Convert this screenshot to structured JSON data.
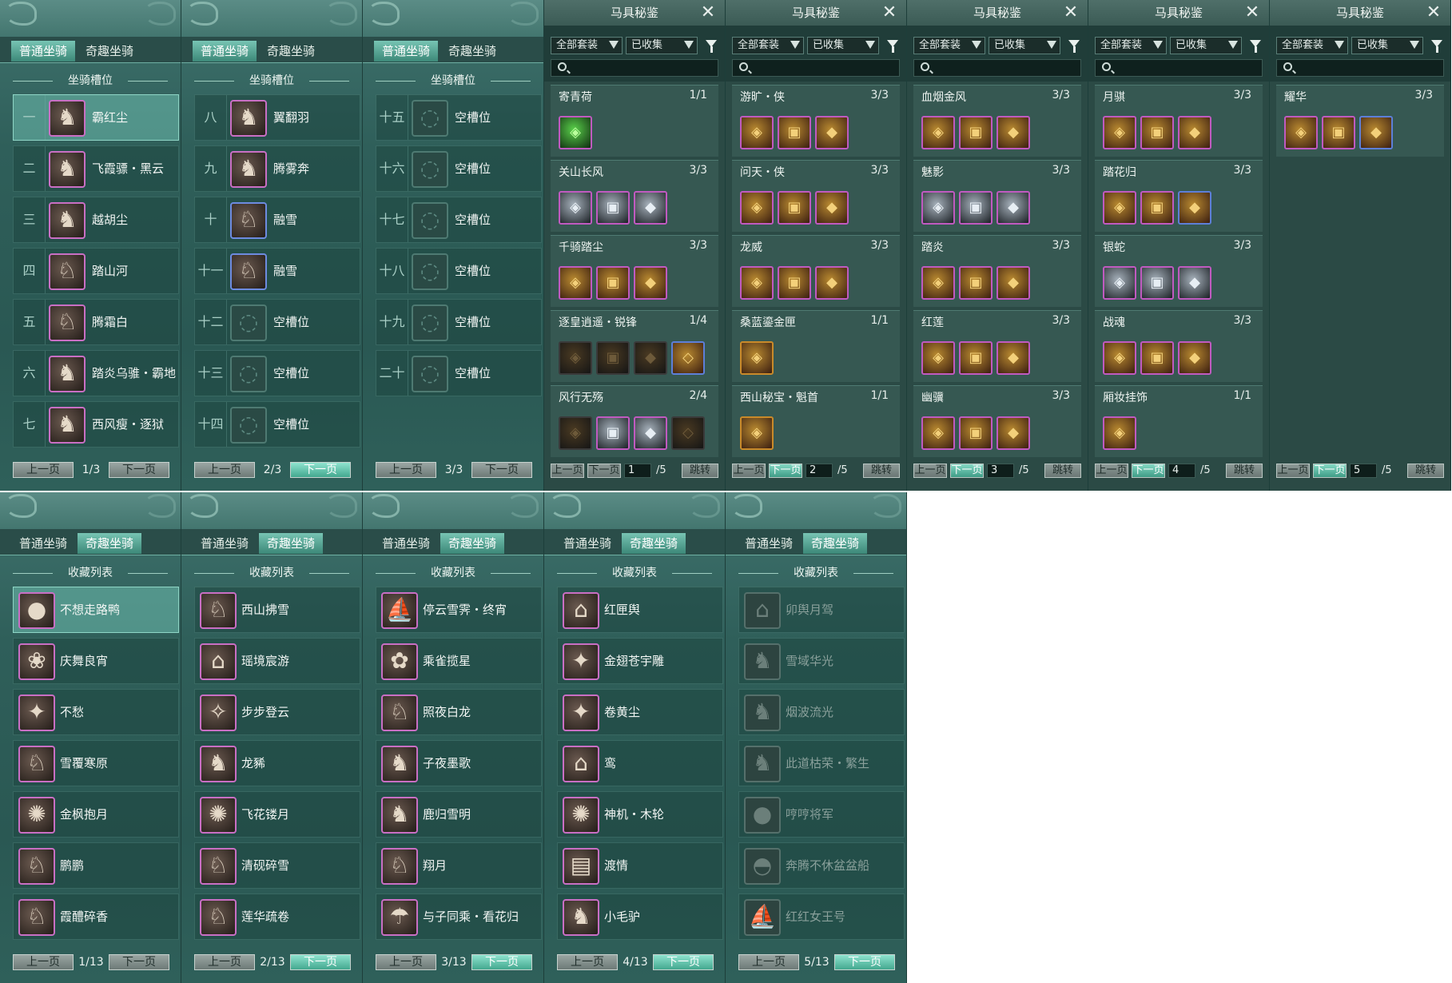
{
  "mount_tabs": {
    "normal": "普通坐骑",
    "fun": "奇趣坐骑"
  },
  "slots_title": "坐骑槽位",
  "collection_title": "收藏列表",
  "pager": {
    "prev": "上一页",
    "next": "下一页"
  },
  "slot_pages": [
    {
      "page": "1/3",
      "rows": [
        {
          "num": "一",
          "name": "霸红尘",
          "icon": "horse-black-icon",
          "frame": "purple",
          "selected": true
        },
        {
          "num": "二",
          "name": "飞霞骠・黑云",
          "icon": "horse-black-icon",
          "frame": "purple"
        },
        {
          "num": "三",
          "name": "越胡尘",
          "icon": "horse-black-icon",
          "frame": "purple"
        },
        {
          "num": "四",
          "name": "踏山河",
          "icon": "horse-white-icon",
          "frame": "purple"
        },
        {
          "num": "五",
          "name": "腾霜白",
          "icon": "horse-white-icon",
          "frame": "purple"
        },
        {
          "num": "六",
          "name": "踏炎乌骓・霸地",
          "icon": "horse-black-icon",
          "frame": "purple"
        },
        {
          "num": "七",
          "name": "西风瘦・逐狱",
          "icon": "horse-black-icon",
          "frame": "purple"
        }
      ]
    },
    {
      "page": "2/3",
      "rows": [
        {
          "num": "八",
          "name": "翼翻羽",
          "icon": "horse-black-icon",
          "frame": "purple"
        },
        {
          "num": "九",
          "name": "腾雾奔",
          "icon": "horse-red-icon",
          "frame": "purple"
        },
        {
          "num": "十",
          "name": "融雪",
          "icon": "horse-white-icon",
          "frame": "blue"
        },
        {
          "num": "十一",
          "name": "融雪",
          "icon": "horse-white-icon",
          "frame": "blue"
        },
        {
          "num": "十二",
          "name": "空槽位",
          "icon": "empty-slot-icon",
          "frame": "empty"
        },
        {
          "num": "十三",
          "name": "空槽位",
          "icon": "empty-slot-icon",
          "frame": "empty"
        },
        {
          "num": "十四",
          "name": "空槽位",
          "icon": "empty-slot-icon",
          "frame": "empty"
        }
      ]
    },
    {
      "page": "3/3",
      "rows": [
        {
          "num": "十五",
          "name": "空槽位",
          "icon": "empty-slot-icon",
          "frame": "empty"
        },
        {
          "num": "十六",
          "name": "空槽位",
          "icon": "empty-slot-icon",
          "frame": "empty"
        },
        {
          "num": "十七",
          "name": "空槽位",
          "icon": "empty-slot-icon",
          "frame": "empty"
        },
        {
          "num": "十八",
          "name": "空槽位",
          "icon": "empty-slot-icon",
          "frame": "empty"
        },
        {
          "num": "十九",
          "name": "空槽位",
          "icon": "empty-slot-icon",
          "frame": "empty"
        },
        {
          "num": "二十",
          "name": "空槽位",
          "icon": "empty-slot-icon",
          "frame": "empty"
        }
      ]
    }
  ],
  "equip": {
    "title": "马具秘鉴",
    "filter_set": "全部套装",
    "filter_collect": "已收集",
    "jump": "跳转",
    "prev": "上一页",
    "next": "下一页",
    "total": "/5",
    "pages": [
      {
        "page": "1",
        "sets": [
          {
            "name": "寄青荷",
            "count": "1/1",
            "pieces": [
              "g"
            ]
          },
          {
            "name": "关山长风",
            "count": "3/3",
            "pieces": [
              "s",
              "s",
              "s"
            ]
          },
          {
            "name": "千骑踏尘",
            "count": "3/3",
            "pieces": [
              "o",
              "o",
              "o"
            ]
          },
          {
            "name": "逐皇逍遥・锐锋",
            "count": "1/4",
            "pieces": [
              "d",
              "d",
              "d",
              "b"
            ]
          },
          {
            "name": "风行无殇",
            "count": "2/4",
            "pieces": [
              "d",
              "s",
              "s",
              "d"
            ]
          }
        ]
      },
      {
        "page": "2",
        "sets": [
          {
            "name": "游旷・侠",
            "count": "3/3",
            "pieces": [
              "o",
              "o",
              "o"
            ]
          },
          {
            "name": "问天・侠",
            "count": "3/3",
            "pieces": [
              "o",
              "o",
              "o"
            ]
          },
          {
            "name": "龙威",
            "count": "3/3",
            "pieces": [
              "o",
              "o",
              "o"
            ]
          },
          {
            "name": "桑蓝鎏金匣",
            "count": "1/1",
            "pieces": [
              "y"
            ]
          },
          {
            "name": "西山秘宝・魁首",
            "count": "1/1",
            "pieces": [
              "y"
            ]
          }
        ]
      },
      {
        "page": "3",
        "sets": [
          {
            "name": "血烟金风",
            "count": "3/3",
            "pieces": [
              "o",
              "o",
              "o"
            ]
          },
          {
            "name": "魅影",
            "count": "3/3",
            "pieces": [
              "s",
              "s",
              "s"
            ]
          },
          {
            "name": "踏炎",
            "count": "3/3",
            "pieces": [
              "o",
              "o",
              "o"
            ]
          },
          {
            "name": "红莲",
            "count": "3/3",
            "pieces": [
              "o",
              "o",
              "o"
            ]
          },
          {
            "name": "幽骥",
            "count": "3/3",
            "pieces": [
              "o",
              "o",
              "o"
            ]
          }
        ]
      },
      {
        "page": "4",
        "sets": [
          {
            "name": "月骐",
            "count": "3/3",
            "pieces": [
              "o",
              "o",
              "o"
            ]
          },
          {
            "name": "踏花归",
            "count": "3/3",
            "pieces": [
              "o",
              "o",
              "b"
            ]
          },
          {
            "name": "银蛇",
            "count": "3/3",
            "pieces": [
              "s",
              "s",
              "s"
            ]
          },
          {
            "name": "战魂",
            "count": "3/3",
            "pieces": [
              "o",
              "o",
              "o"
            ]
          },
          {
            "name": "厢妆挂饰",
            "count": "1/1",
            "pieces": [
              "o"
            ]
          }
        ]
      },
      {
        "page": "5",
        "sets": [
          {
            "name": "耀华",
            "count": "3/3",
            "pieces": [
              "o",
              "o",
              "b"
            ]
          }
        ]
      }
    ]
  },
  "collection_pages": [
    {
      "page": "1/13",
      "rows": [
        {
          "name": "不想走路鸭",
          "icon": "duck-icon",
          "selected": true
        },
        {
          "name": "庆舞良宵",
          "icon": "lion-dance-icon"
        },
        {
          "name": "不愁",
          "icon": "bird-icon"
        },
        {
          "name": "雪覆寒原",
          "icon": "white-beast-icon"
        },
        {
          "name": "金枫抱月",
          "icon": "golden-orb-icon"
        },
        {
          "name": "鹏鹏",
          "icon": "white-sheep-icon"
        },
        {
          "name": "霞醴碎香",
          "icon": "unicorn-icon"
        }
      ]
    },
    {
      "page": "2/13",
      "rows": [
        {
          "name": "西山拂雪",
          "icon": "white-deer-icon"
        },
        {
          "name": "瑶境宸游",
          "icon": "carriage-icon"
        },
        {
          "name": "步步登云",
          "icon": "golden-wings-icon"
        },
        {
          "name": "龙豨",
          "icon": "dragon-boar-icon"
        },
        {
          "name": "飞花镂月",
          "icon": "golden-orb-icon"
        },
        {
          "name": "清砚碎雪",
          "icon": "white-horse-icon"
        },
        {
          "name": "莲华疏卷",
          "icon": "white-horse-icon"
        }
      ]
    },
    {
      "page": "3/13",
      "rows": [
        {
          "name": "停云雪霁・终宵",
          "icon": "boat-icon"
        },
        {
          "name": "乘雀揽星",
          "icon": "lotus-icon"
        },
        {
          "name": "照夜白龙",
          "icon": "white-dragon-icon"
        },
        {
          "name": "子夜墨歌",
          "icon": "black-dragon-icon"
        },
        {
          "name": "鹿归雪明",
          "icon": "deer-icon"
        },
        {
          "name": "翔月",
          "icon": "white-beast-icon"
        },
        {
          "name": "与子同乘・看花归",
          "icon": "umbrella-icon"
        }
      ]
    },
    {
      "page": "4/13",
      "rows": [
        {
          "name": "红匣舆",
          "icon": "red-carriage-icon"
        },
        {
          "name": "金翅苍宇雕",
          "icon": "eagle-icon"
        },
        {
          "name": "卷黄尘",
          "icon": "rooster-icon"
        },
        {
          "name": "鸾",
          "icon": "lantern-icon"
        },
        {
          "name": "神机・木轮",
          "icon": "wheel-icon"
        },
        {
          "name": "渡情",
          "icon": "raft-icon"
        },
        {
          "name": "小毛驴",
          "icon": "donkey-icon"
        }
      ]
    },
    {
      "page": "5/13",
      "rows": [
        {
          "name": "卯舆月驾",
          "icon": "rabbit-carriage-icon",
          "dim": true
        },
        {
          "name": "雪域华光",
          "icon": "antelope-icon",
          "dim": true
        },
        {
          "name": "烟波流光",
          "icon": "dragon-icon",
          "dim": true
        },
        {
          "name": "此道枯荣・繁生",
          "icon": "deer-icon",
          "dim": true
        },
        {
          "name": "哼哼将军",
          "icon": "pig-icon",
          "dim": true
        },
        {
          "name": "奔腾不休盆盆船",
          "icon": "basin-boat-icon",
          "dim": true
        },
        {
          "name": "红红女王号",
          "icon": "ship-icon",
          "dim": true
        }
      ]
    }
  ]
}
